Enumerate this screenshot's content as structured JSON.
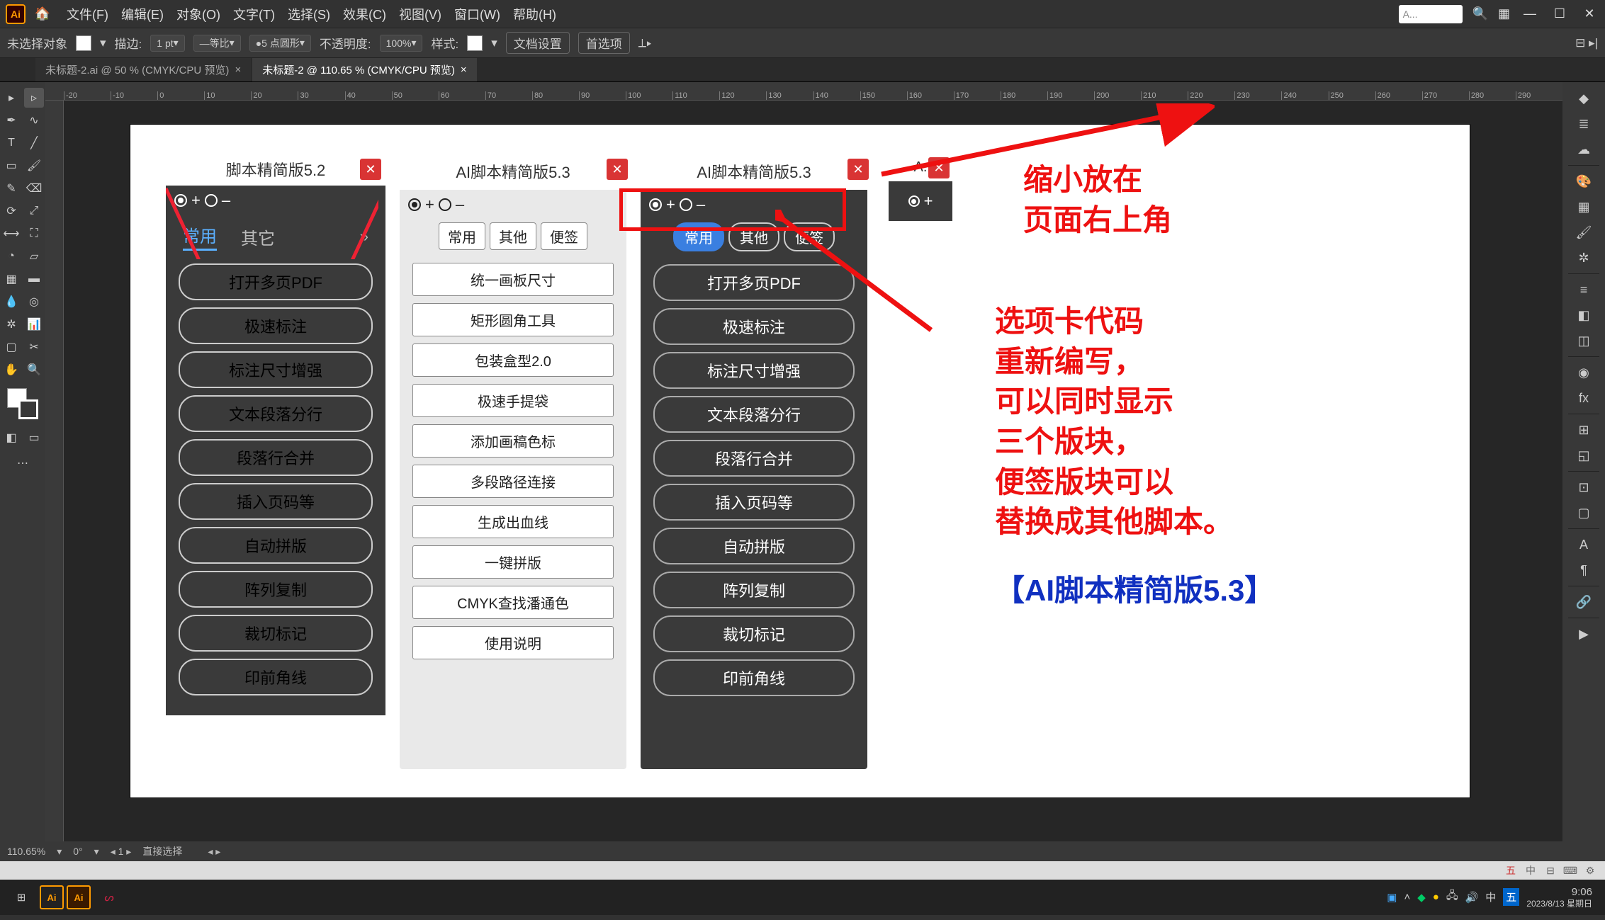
{
  "menubar": {
    "items": [
      "文件(F)",
      "编辑(E)",
      "对象(O)",
      "文字(T)",
      "选择(S)",
      "效果(C)",
      "视图(V)",
      "窗口(W)",
      "帮助(H)"
    ],
    "search_placeholder": "A..."
  },
  "optbar": {
    "no_selection": "未选择对象",
    "stroke": "描边:",
    "stroke_val": "1 pt",
    "uniform": "等比",
    "point": "5 点圆形",
    "opacity_lbl": "不透明度:",
    "opacity_val": "100%",
    "style": "样式:",
    "doc_set": "文档设置",
    "prefs": "首选项"
  },
  "doctabs": {
    "tab1": "未标题-2.ai @ 50 % (CMYK/CPU 预览)",
    "tab2": "未标题-2 @ 110.65 % (CMYK/CPU 预览)"
  },
  "ruler_marks": [
    "-20",
    "-10",
    "0",
    "10",
    "20",
    "30",
    "40",
    "50",
    "60",
    "70",
    "80",
    "90",
    "100",
    "110",
    "120",
    "130",
    "140",
    "150",
    "160",
    "170",
    "180",
    "190",
    "200",
    "210",
    "220",
    "230",
    "240",
    "250",
    "260",
    "270",
    "280",
    "290"
  ],
  "panel1": {
    "title": "脚本精简版5.2",
    "tabs": {
      "t1": "常用",
      "t2": "其它",
      "more": "»"
    },
    "buttons": [
      "打开多页PDF",
      "极速标注",
      "标注尺寸增强",
      "文本段落分行",
      "段落行合并",
      "插入页码等",
      "自动拼版",
      "阵列复制",
      "裁切标记",
      "印前角线"
    ]
  },
  "panel2": {
    "title": "AI脚本精简版5.3",
    "tabs": {
      "t1": "常用",
      "t2": "其他",
      "t3": "便签"
    },
    "buttons": [
      "统一画板尺寸",
      "矩形圆角工具",
      "包装盒型2.0",
      "极速手提袋",
      "添加画稿色标",
      "多段路径连接",
      "生成出血线",
      "一键拼版",
      "CMYK查找潘通色",
      "使用说明"
    ]
  },
  "panel3": {
    "title": "AI脚本精简版5.3",
    "tabs": {
      "t1": "常用",
      "t2": "其他",
      "t3": "便签"
    },
    "buttons": [
      "打开多页PDF",
      "极速标注",
      "标注尺寸增强",
      "文本段落分行",
      "段落行合并",
      "插入页码等",
      "自动拼版",
      "阵列复制",
      "裁切标记",
      "印前角线"
    ]
  },
  "panel_min": {
    "title": "A."
  },
  "annotations": {
    "a1": "缩小放在\n页面右上角",
    "a2": "选项卡代码\n重新编写，\n可以同时显示\n三个版块，\n便签版块可以\n替换成其他脚本。",
    "a3": "【AI脚本精简版5.3】"
  },
  "status": {
    "zoom": "110.65%",
    "angle": "0°",
    "art": "1",
    "tool": "直接选择"
  },
  "artifact": {
    "ime": "中",
    "split": "⊟"
  },
  "taskbar": {
    "time": "9:06",
    "date": "2023/8/13 星期日"
  }
}
